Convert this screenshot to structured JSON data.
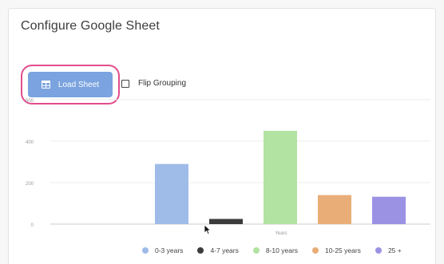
{
  "header": {
    "title": "Configure Google Sheet"
  },
  "toolbar": {
    "load_label": "Load Sheet",
    "load_icon": "table-grid-icon",
    "flip_label": "Flip Grouping",
    "flip_checked": false
  },
  "highlight_color": "#e24d8c",
  "chart_data": {
    "type": "bar",
    "xlabel": "Years",
    "ylabel": "",
    "ylim": [
      0,
      600
    ],
    "yticks": [
      0,
      200,
      400,
      600
    ],
    "grid": true,
    "legend_position": "bottom",
    "series": [
      {
        "name": "0-3 years",
        "value": 290,
        "color": "#9fbbe8"
      },
      {
        "name": "4-7 years",
        "value": 25,
        "color": "#3b3b3b"
      },
      {
        "name": "8-10 years",
        "value": 450,
        "color": "#b2e3a2"
      },
      {
        "name": "10-25 years",
        "value": 140,
        "color": "#e9ae77"
      },
      {
        "name": "25 +",
        "value": 132,
        "color": "#9b92e4"
      }
    ]
  }
}
